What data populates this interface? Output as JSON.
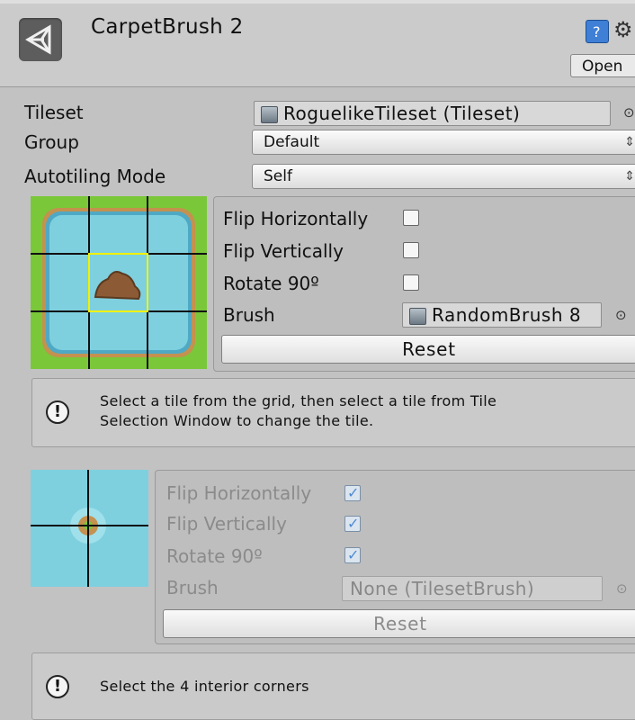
{
  "header": {
    "title": "CarpetBrush 2",
    "open_label": "Open",
    "icons": [
      "unity-logo-icon",
      "help-icon",
      "gear-icon"
    ]
  },
  "fields": {
    "tileset_label": "Tileset",
    "tileset_value": "RoguelikeTileset (Tileset)",
    "group_label": "Group",
    "group_value": "Default",
    "autotiling_label": "Autotiling Mode",
    "autotiling_value": "Self",
    "picker_glyph": "⊙",
    "dropdown_arrow": "⇕"
  },
  "tile_panel_1": {
    "flip_h_label": "Flip Horizontally",
    "flip_v_label": "Flip Vertically",
    "rotate_label": "Rotate 90º",
    "brush_label": "Brush",
    "brush_value": "RandomBrush 8",
    "flip_h": false,
    "flip_v": false,
    "rotate": false,
    "reset_label": "Reset"
  },
  "help_1": {
    "line1": "Select  a tile from the grid, then select a tile from Tile",
    "line2": "Selection Window to change the tile."
  },
  "tile_panel_2": {
    "flip_h_label": "Flip Horizontally",
    "flip_v_label": "Flip Vertically",
    "rotate_label": "Rotate 90º",
    "brush_label": "Brush",
    "brush_value": "None (TilesetBrush)",
    "flip_h": true,
    "flip_v": true,
    "rotate": true,
    "reset_label": "Reset"
  },
  "help_2": {
    "line1": "Select the 4 interior corners"
  },
  "glyphs": {
    "info": "!",
    "check": "✓"
  },
  "colors": {
    "grass": "#7ac73a",
    "water": "#7ed0df",
    "water_edge": "#4fa9c4",
    "selection": "#f1f100",
    "dirt": "#8c5a34"
  }
}
